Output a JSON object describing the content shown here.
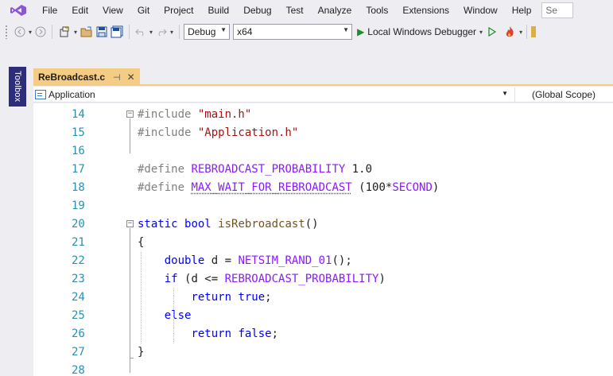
{
  "menu": {
    "logo_icon": "visual-studio-logo-icon",
    "items": [
      "File",
      "Edit",
      "View",
      "Git",
      "Project",
      "Build",
      "Debug",
      "Test",
      "Analyze",
      "Tools",
      "Extensions",
      "Window",
      "Help"
    ],
    "search_text": "Se"
  },
  "toolbar": {
    "configuration": "Debug",
    "platform": "x64",
    "debugger_label": "Local Windows Debugger",
    "icons": [
      "back-icon",
      "forward-icon",
      "new-project-icon",
      "open-file-icon",
      "save-icon",
      "save-all-icon",
      "undo-icon",
      "redo-icon",
      "start-without-debugging-icon",
      "hot-reload-icon"
    ]
  },
  "toolbox": {
    "label": "Toolbox"
  },
  "tab": {
    "title": "ReBroadcast.c",
    "pin_glyph": "⊣",
    "close_glyph": "✕"
  },
  "navbar": {
    "project": "Application",
    "scope": "(Global Scope)"
  },
  "editor": {
    "colors": {
      "keyword": "#0000ff",
      "string": "#a31515",
      "macro": "#8a1bff",
      "function": "#74531f",
      "line_number": "#2b91af",
      "preprocessor": "#808080"
    },
    "lines": [
      {
        "num": "14",
        "tokens": [
          {
            "t": "#include ",
            "c": "pp"
          },
          {
            "t": "\"main.h\"",
            "c": "str"
          }
        ]
      },
      {
        "num": "15",
        "tokens": [
          {
            "t": "#include ",
            "c": "pp"
          },
          {
            "t": "\"Application.h\"",
            "c": "str"
          }
        ]
      },
      {
        "num": "16",
        "tokens": []
      },
      {
        "num": "17",
        "tokens": [
          {
            "t": "#define ",
            "c": "pp"
          },
          {
            "t": "REBROADCAST_PROBABILITY",
            "c": "mac"
          },
          {
            "t": " 1.0",
            "c": "num"
          }
        ]
      },
      {
        "num": "18",
        "tokens": [
          {
            "t": "#define ",
            "c": "pp"
          },
          {
            "t": "MAX_WAIT_FOR_REBROADCAST",
            "c": "mac squiggle"
          },
          {
            "t": " (100*",
            "c": "num"
          },
          {
            "t": "SECOND",
            "c": "mac"
          },
          {
            "t": ")",
            "c": "num"
          }
        ]
      },
      {
        "num": "19",
        "tokens": []
      },
      {
        "num": "20",
        "tokens": [
          {
            "t": "static ",
            "c": "kw"
          },
          {
            "t": "bool ",
            "c": "kw"
          },
          {
            "t": "isRebroadcast",
            "c": "fn"
          },
          {
            "t": "()",
            "c": "num"
          }
        ]
      },
      {
        "num": "21",
        "tokens": [
          {
            "t": "{",
            "c": "num"
          }
        ]
      },
      {
        "num": "22",
        "tokens": [
          {
            "t": "    ",
            "c": "num"
          },
          {
            "t": "double ",
            "c": "kw"
          },
          {
            "t": "d = ",
            "c": "num"
          },
          {
            "t": "NETSIM_RAND_01",
            "c": "mac"
          },
          {
            "t": "();",
            "c": "num"
          }
        ]
      },
      {
        "num": "23",
        "tokens": [
          {
            "t": "    ",
            "c": "num"
          },
          {
            "t": "if ",
            "c": "kw"
          },
          {
            "t": "(d <= ",
            "c": "num"
          },
          {
            "t": "REBROADCAST_PROBABILITY",
            "c": "mac"
          },
          {
            "t": ")",
            "c": "num"
          }
        ]
      },
      {
        "num": "24",
        "tokens": [
          {
            "t": "        ",
            "c": "num"
          },
          {
            "t": "return ",
            "c": "kw"
          },
          {
            "t": "true",
            "c": "kw"
          },
          {
            "t": ";",
            "c": "num"
          }
        ]
      },
      {
        "num": "25",
        "tokens": [
          {
            "t": "    ",
            "c": "num"
          },
          {
            "t": "else",
            "c": "kw"
          }
        ]
      },
      {
        "num": "26",
        "tokens": [
          {
            "t": "        ",
            "c": "num"
          },
          {
            "t": "return ",
            "c": "kw"
          },
          {
            "t": "false",
            "c": "kw"
          },
          {
            "t": ";",
            "c": "num"
          }
        ]
      },
      {
        "num": "27",
        "tokens": [
          {
            "t": "}",
            "c": "num"
          }
        ]
      },
      {
        "num": "28",
        "tokens": []
      }
    ]
  }
}
